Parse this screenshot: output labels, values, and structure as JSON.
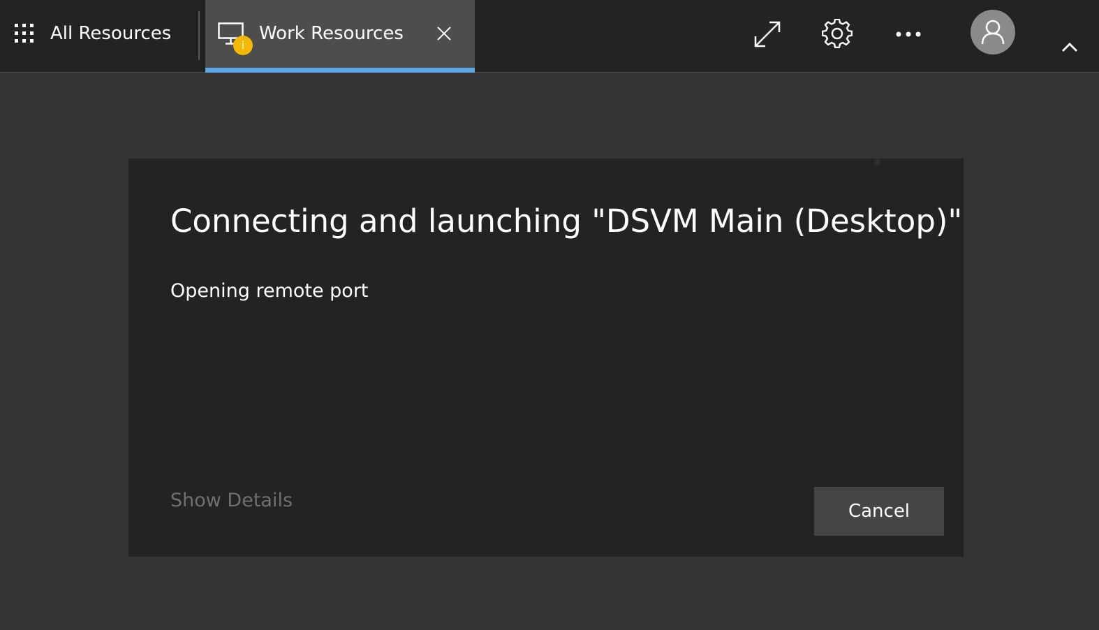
{
  "header": {
    "apps_icon": "grid-icon",
    "all_resources_label": "All Resources",
    "tab": {
      "label": "Work Resources",
      "icon": "monitor-icon",
      "badge": "i",
      "close_icon": "close-icon",
      "active": true
    },
    "actions": [
      {
        "name": "expand",
        "icon": "expand-icon"
      },
      {
        "name": "settings",
        "icon": "gear-icon"
      },
      {
        "name": "more",
        "icon": "more-icon"
      },
      {
        "name": "account",
        "icon": "user-icon"
      },
      {
        "name": "collapse",
        "icon": "chevron-up-icon"
      }
    ]
  },
  "dialog": {
    "title": "Connecting and launching \"DSVM Main (Desktop)\"",
    "status": "Opening remote port",
    "show_details_label": "Show Details",
    "cancel_label": "Cancel"
  },
  "colors": {
    "background": "#333333",
    "topbar": "#232323",
    "tab_active": "#4d4d4d",
    "tab_accent": "#5aa7e8",
    "badge": "#f5b800",
    "dialog": "#232323",
    "button": "#454545"
  }
}
